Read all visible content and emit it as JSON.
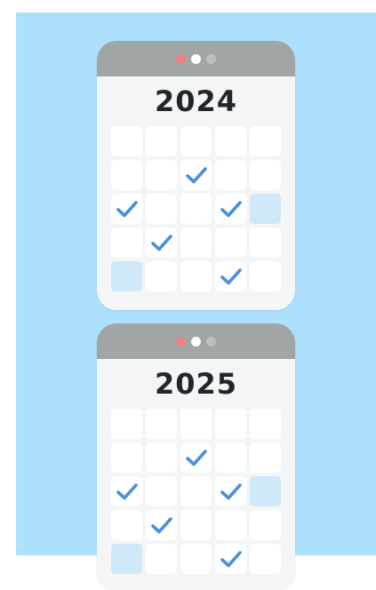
{
  "calendars": [
    {
      "year": "2024",
      "window_dots": [
        "red",
        "white",
        "grey"
      ],
      "rows": [
        [
          "empty",
          "empty",
          "empty",
          "empty",
          "empty"
        ],
        [
          "empty",
          "empty",
          "check",
          "empty",
          "empty"
        ],
        [
          "check",
          "empty",
          "empty",
          "check",
          "highlight"
        ],
        [
          "empty",
          "check",
          "empty",
          "empty",
          "empty"
        ],
        [
          "highlight",
          "empty",
          "empty",
          "check",
          "empty"
        ]
      ]
    },
    {
      "year": "2025",
      "window_dots": [
        "red",
        "white",
        "grey"
      ],
      "rows": [
        [
          "empty",
          "empty",
          "empty",
          "empty",
          "empty"
        ],
        [
          "empty",
          "empty",
          "check",
          "empty",
          "empty"
        ],
        [
          "check",
          "empty",
          "empty",
          "check",
          "highlight"
        ],
        [
          "empty",
          "check",
          "empty",
          "empty",
          "empty"
        ],
        [
          "highlight",
          "empty",
          "empty",
          "check",
          "empty"
        ]
      ]
    }
  ],
  "colors": {
    "background": "#ade0fc",
    "card": "#f4f5f6",
    "titlebar": "#a0a6a6",
    "check": "#4a90d9",
    "highlight": "#cfe8fa"
  },
  "icons": {
    "cell_mark": "checkmark-icon",
    "window_controls": "window-dot-icon"
  }
}
